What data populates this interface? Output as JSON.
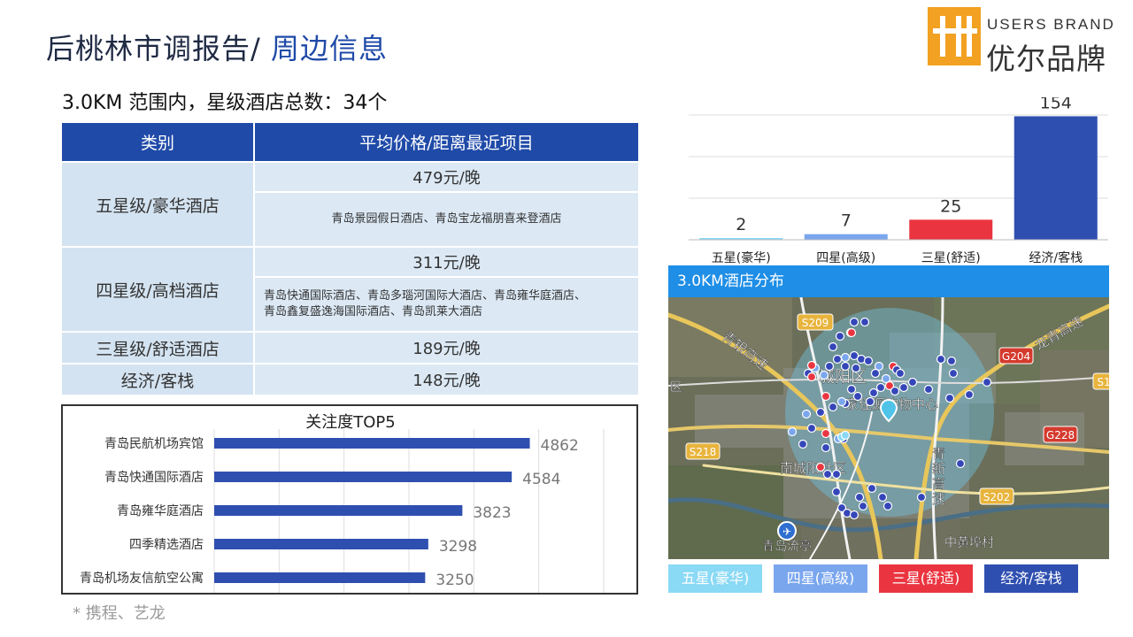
{
  "header": {
    "title_main": "后桃林市调报告/",
    "title_accent": " 周边信息",
    "logo_en": "USERS BRAND",
    "logo_zh": "优尔品牌",
    "brand_color": "#f2a122"
  },
  "summary": {
    "text": "3.0KM 范围内，星级酒店总数：34个"
  },
  "table": {
    "col1": "类别",
    "col2": "平均价格/距离最近项目",
    "rows": [
      {
        "category": "五星级/豪华酒店",
        "price": "479元/晚",
        "nearest": "青岛景园假日酒店、青岛宝龙福朋喜来登酒店"
      },
      {
        "category": "四星级/高档酒店",
        "price": "311元/晚",
        "nearest_line1": "青岛快通国际酒店、青岛多瑙河国际大酒店、青岛雍华庭酒店、",
        "nearest_line2": "青岛鑫复盛逸海国际酒店、青岛凯莱大酒店"
      },
      {
        "category": "三星级/舒适酒店",
        "price": "189元/晚"
      },
      {
        "category": "经济/客栈",
        "price": "148元/晚"
      }
    ]
  },
  "source_note": "* 携程、艺龙",
  "map": {
    "title": "3.0KM酒店分布",
    "labels": {
      "s209": "S209",
      "qingyin": "青银高速",
      "longqing": "龙青高速",
      "g204": "G204",
      "s1": "S1",
      "qu": "区",
      "chengyang": "城阳区",
      "jiazhuyuan": "家佳源购物中心",
      "s218": "S218",
      "g228": "G228",
      "qingxin": "青新高速",
      "nancheng": "南城阳社区",
      "s202": "S202",
      "liuting": "青岛流亭",
      "zhonghuangbu": "中黄埠村"
    }
  },
  "legend": {
    "five": "五星(豪华)",
    "four": "四星(高级)",
    "three": "三星(舒适)",
    "budget": "经济/客栈"
  },
  "chart_data": [
    {
      "type": "bar",
      "orientation": "vertical",
      "categories": [
        "五星(豪华)",
        "四星(高级)",
        "三星(舒适)",
        "经济/客栈"
      ],
      "values": [
        2,
        7,
        25,
        154
      ],
      "colors": [
        "#8ad9f5",
        "#7aa6ee",
        "#ea3540",
        "#2f4fb0"
      ],
      "ylim": [
        0,
        160
      ],
      "grid": true,
      "data_labels": true
    },
    {
      "type": "bar",
      "orientation": "horizontal",
      "title": "关注度TOP5",
      "categories": [
        "青岛民航机场宾馆",
        "青岛快通国际酒店",
        "青岛雍华庭酒店",
        "四季精选酒店",
        "青岛机场友信航空公寓"
      ],
      "values": [
        4862,
        4584,
        3823,
        3298,
        3250
      ],
      "color": "#2f4fb0",
      "xlim": [
        0,
        6000
      ],
      "grid": true,
      "data_labels": true
    }
  ]
}
